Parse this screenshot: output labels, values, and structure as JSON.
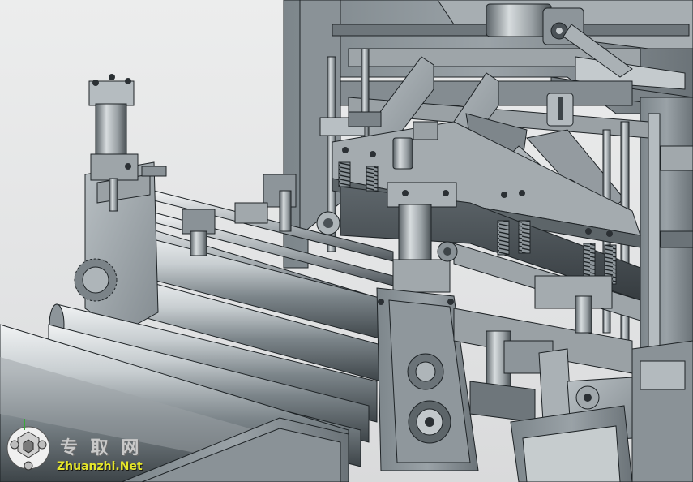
{
  "watermark": {
    "chinese_text": "专 取 网",
    "site_text": "Zhuanzhi.Net",
    "text_color": "#e6e62a"
  },
  "colors": {
    "background": "#e6e7e8",
    "metal_light": "#c5cacd",
    "metal_mid": "#8d9499",
    "metal_dark": "#4b5257",
    "edge": "#1e2326"
  }
}
